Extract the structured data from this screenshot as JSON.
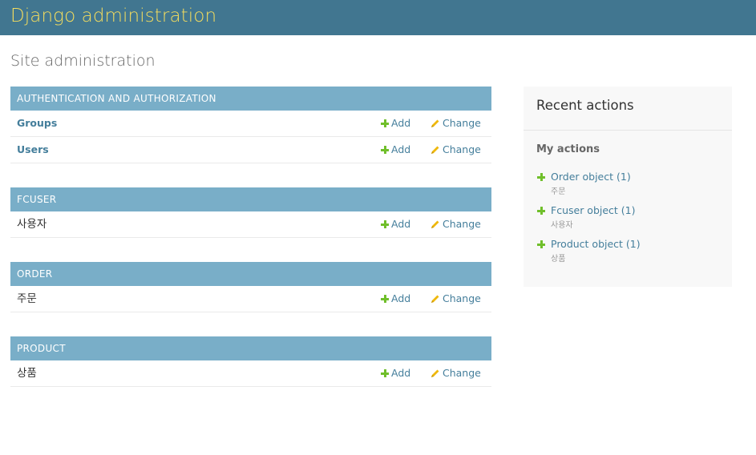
{
  "header": {
    "title": "Django administration"
  },
  "page": {
    "title": "Site administration"
  },
  "modules": [
    {
      "caption": "AUTHENTICATION AND AUTHORIZATION",
      "models": [
        {
          "name": "Groups",
          "add_label": "Add",
          "change_label": "Change"
        },
        {
          "name": "Users",
          "add_label": "Add",
          "change_label": "Change"
        }
      ]
    },
    {
      "caption": "FCUSER",
      "models": [
        {
          "name": "사용자",
          "add_label": "Add",
          "change_label": "Change"
        }
      ]
    },
    {
      "caption": "ORDER",
      "models": [
        {
          "name": "주문",
          "add_label": "Add",
          "change_label": "Change"
        }
      ]
    },
    {
      "caption": "PRODUCT",
      "models": [
        {
          "name": "상품",
          "add_label": "Add",
          "change_label": "Change"
        }
      ]
    }
  ],
  "recent": {
    "title": "Recent actions",
    "subtitle": "My actions",
    "items": [
      {
        "label": "Order object (1)",
        "type": "주문"
      },
      {
        "label": "Fcuser object (1)",
        "type": "사용자"
      },
      {
        "label": "Product object (1)",
        "type": "상품"
      }
    ]
  },
  "colors": {
    "header_bg": "#417690",
    "title_yellow": "#f5dd5d",
    "caption_bg": "#79aec8",
    "link_blue": "#447e9b",
    "add_green": "#70bf2b",
    "change_yellow": "#efb80b"
  },
  "icons": {
    "add": "plus-icon",
    "change": "pencil-icon"
  }
}
